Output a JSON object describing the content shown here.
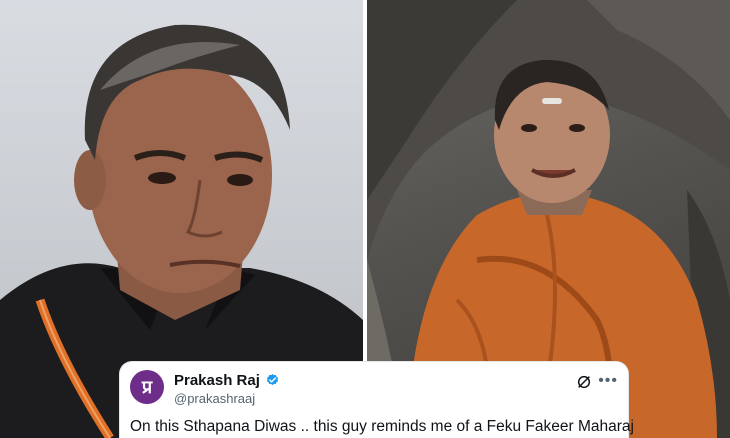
{
  "tweet": {
    "avatar_letter": "प्र",
    "name": "Prakash Raj",
    "handle": "@prakashraaj",
    "text": "On this Sthapana Diwas .. this guy reminds me of a Feku Fakeer Maharaj"
  },
  "icons": {
    "verified": "verified-badge-icon",
    "grok": "grok-icon",
    "more": "more-options-icon"
  },
  "colors": {
    "verified": "#1d9bf0",
    "avatar_bg": "#6f2d8a",
    "robe": "#c8672a"
  }
}
